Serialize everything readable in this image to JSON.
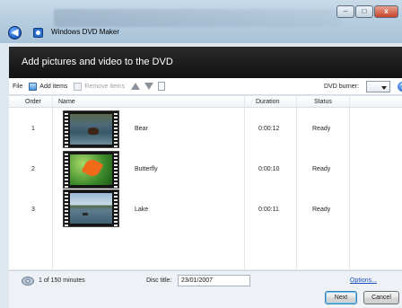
{
  "window": {
    "title": "Windows DVD Maker",
    "buttons": [
      "–",
      "□",
      "x"
    ]
  },
  "header": {
    "title": "Add pictures and video to the DVD"
  },
  "toolbar": {
    "file_label": "File",
    "add_items_label": "Add items",
    "remove_items_label": "Remove items",
    "dvd_burner_label": "DVD burner:",
    "dvd_burner_value": ""
  },
  "list": {
    "columns": [
      "Order",
      "Name",
      "Duration",
      "Status"
    ],
    "rows": [
      {
        "order": "1",
        "name": "Bear",
        "duration": "0:00:12",
        "status": "Ready",
        "thumbnail": "bear-video"
      },
      {
        "order": "2",
        "name": "Butterfly",
        "duration": "0:00:10",
        "status": "Ready",
        "thumbnail": "butterfly-video"
      },
      {
        "order": "3",
        "name": "Lake",
        "duration": "0:00:11",
        "status": "Ready",
        "thumbnail": "lake-video"
      }
    ]
  },
  "footer": {
    "minutes_text": "1 of 150 minutes",
    "disc_title_label": "Disc title:",
    "disc_title_value": "23/01/2007",
    "options_link": "Options...",
    "next_button": "Next",
    "cancel_button": "Cancel"
  },
  "icons": {
    "back": "back-arrow-icon",
    "app": "dvd-maker-icon",
    "add": "add-items-icon",
    "remove": "remove-items-icon",
    "move_up": "move-up-icon",
    "move_down": "move-down-icon",
    "properties": "properties-icon",
    "help": "help-icon",
    "disc": "disc-icon"
  }
}
